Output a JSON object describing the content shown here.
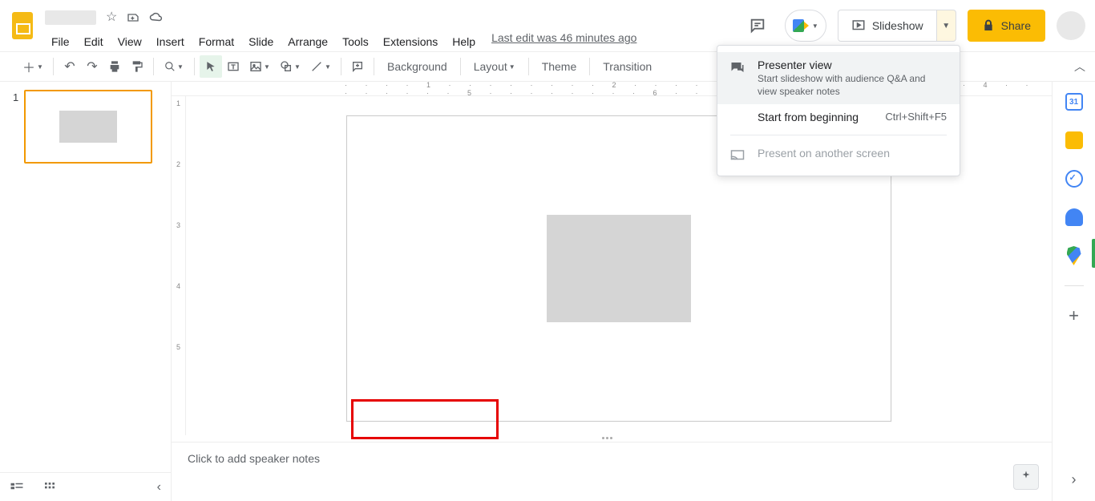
{
  "header": {
    "last_edit": "Last edit was 46 minutes ago",
    "slideshow_label": "Slideshow",
    "share_label": "Share"
  },
  "menubar": [
    "File",
    "Edit",
    "View",
    "Insert",
    "Format",
    "Slide",
    "Arrange",
    "Tools",
    "Extensions",
    "Help"
  ],
  "toolbar": {
    "background": "Background",
    "layout": "Layout",
    "theme": "Theme",
    "transition": "Transition"
  },
  "dropdown": {
    "presenter_title": "Presenter view",
    "presenter_sub": "Start slideshow with audience Q&A and view speaker notes",
    "start_beginning": "Start from beginning",
    "start_shortcut": "Ctrl+Shift+F5",
    "present_another": "Present on another screen"
  },
  "filmstrip": {
    "slide_number": "1"
  },
  "ruler_h": "· · · · 1 · · · · · · · · 2 · · · · · · · · 3 · · · · · · · · 4 · · · · · · · · 5 · · · · · · · · 6 · · · · · · · · 7 · · · ·",
  "ruler_v": [
    "1",
    "2",
    "3",
    "4",
    "5"
  ],
  "notes": {
    "placeholder": "Click to add speaker notes"
  },
  "sidepanel": {
    "calendar_day": "31"
  }
}
